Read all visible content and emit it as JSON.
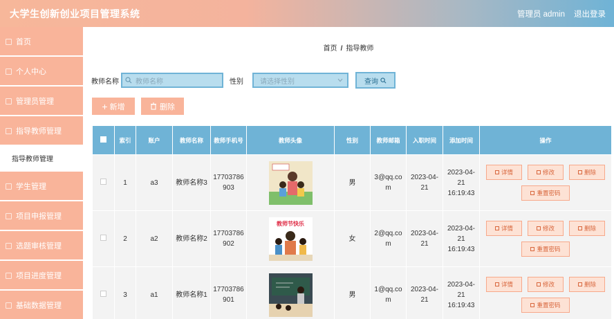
{
  "header": {
    "title": "大学生创新创业项目管理系统",
    "user": "管理员 admin",
    "logout": "退出登录"
  },
  "sidebar": {
    "items": [
      {
        "label": "首页"
      },
      {
        "label": "个人中心"
      },
      {
        "label": "管理员管理"
      },
      {
        "label": "指导教师管理"
      }
    ],
    "sub": "指导教师管理",
    "items2": [
      {
        "label": "学生管理"
      },
      {
        "label": "项目申报管理"
      },
      {
        "label": "选题审核管理"
      },
      {
        "label": "项目进度管理"
      },
      {
        "label": "基础数据管理"
      }
    ]
  },
  "breadcrumb": {
    "home": "首页",
    "sep": "/",
    "current": "指导教师"
  },
  "search": {
    "name_label": "教师名称",
    "name_placeholder": "教师名称",
    "gender_label": "性别",
    "gender_placeholder": "请选择性别",
    "query_label": "查询"
  },
  "actions": {
    "add": "新增",
    "delete": "删除"
  },
  "table": {
    "headers": [
      "索引",
      "账户",
      "教师名称",
      "教师手机号",
      "教师头像",
      "性别",
      "教师邮箱",
      "入职时间",
      "添加时间",
      "操作"
    ],
    "rows": [
      {
        "index": "1",
        "account": "a3",
        "name": "教师名称3",
        "phone": "17703786903",
        "gender": "男",
        "email": "3@qq.com",
        "hire": "2023-04-21",
        "added": "2023-04-21 16:19:43"
      },
      {
        "index": "2",
        "account": "a2",
        "name": "教师名称2",
        "phone": "17703786902",
        "gender": "女",
        "email": "2@qq.com",
        "hire": "2023-04-21",
        "added": "2023-04-21 16:19:43"
      },
      {
        "index": "3",
        "account": "a1",
        "name": "教师名称1",
        "phone": "17703786901",
        "gender": "男",
        "email": "1@qq.com",
        "hire": "2023-04-21",
        "added": "2023-04-21 16:19:43"
      }
    ],
    "avatar_captions": {
      "row2": "教师节快乐"
    },
    "row_actions": {
      "detail": "详情",
      "edit": "修改",
      "delete": "删除",
      "reset": "重置密码"
    }
  },
  "colors": {
    "accent": "#f9b49a",
    "primary": "#6fb3d6"
  }
}
